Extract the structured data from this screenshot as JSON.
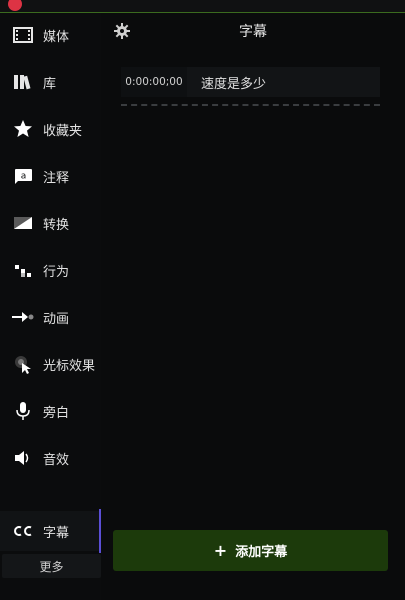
{
  "app": {
    "title": "字幕"
  },
  "sidebar": {
    "items": [
      {
        "label": "媒体",
        "icon": "film-icon"
      },
      {
        "label": "库",
        "icon": "library-icon"
      },
      {
        "label": "收藏夹",
        "icon": "star-icon"
      },
      {
        "label": "注释",
        "icon": "annotation-icon"
      },
      {
        "label": "转换",
        "icon": "transition-icon"
      },
      {
        "label": "行为",
        "icon": "behavior-icon"
      },
      {
        "label": "动画",
        "icon": "animation-icon"
      },
      {
        "label": "光标效果",
        "icon": "cursor-effect-icon"
      },
      {
        "label": "旁白",
        "icon": "microphone-icon"
      },
      {
        "label": "音效",
        "icon": "speaker-icon"
      },
      {
        "label": "字幕",
        "icon": "cc-icon",
        "active": true
      }
    ],
    "more_label": "更多"
  },
  "panel": {
    "title": "字幕",
    "captions": [
      {
        "time": "0:00:00;00",
        "text": "速度是多少"
      }
    ],
    "add_button_label": "添加字幕",
    "add_button_icon": "plus-icon"
  },
  "colors": {
    "accent_green": "#1c3a0b",
    "active_indicator": "#5b4fd6"
  }
}
